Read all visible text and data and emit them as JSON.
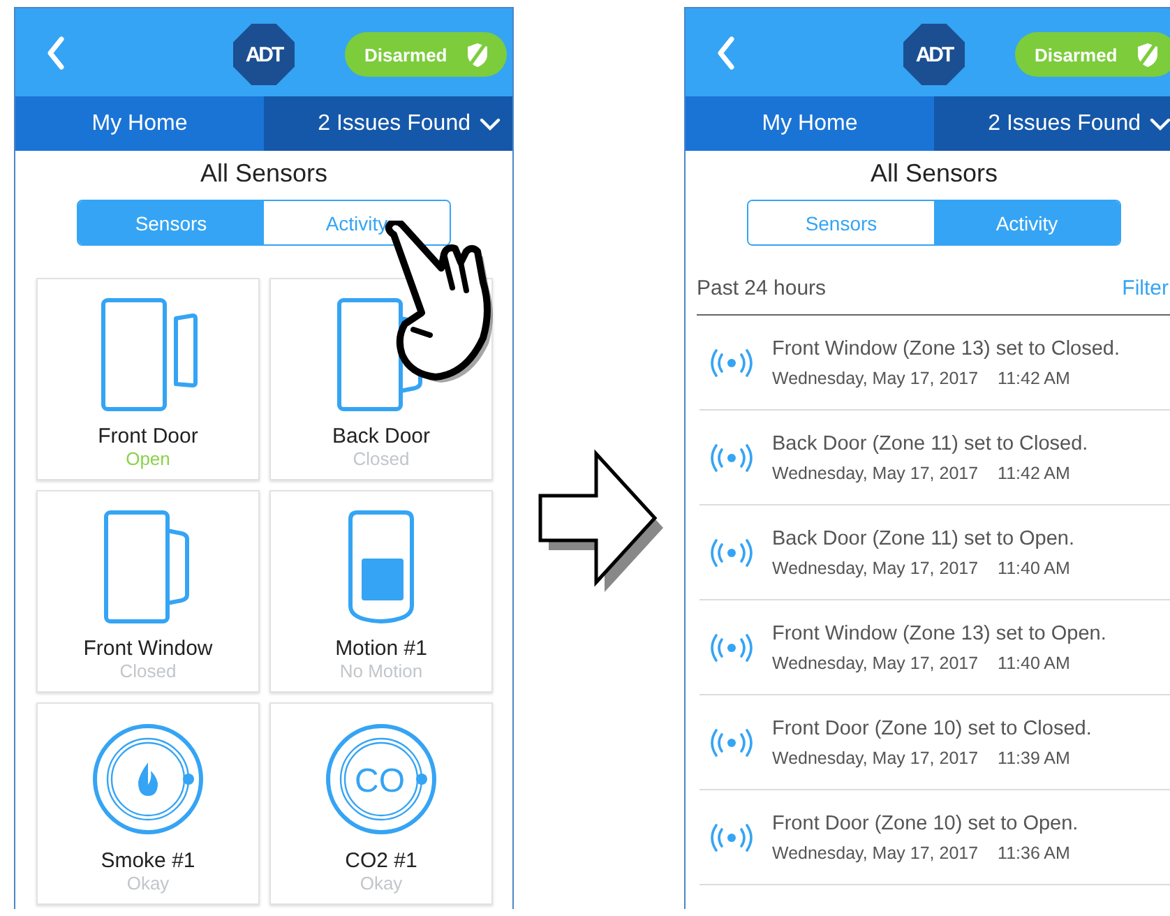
{
  "screens": [
    {
      "header": {
        "logo": "ADT",
        "status": "Disarmed"
      },
      "nav": {
        "home": "My Home",
        "issues": "2 Issues Found"
      },
      "title": "All Sensors",
      "segments": [
        {
          "label": "Sensors",
          "selected": true
        },
        {
          "label": "Activity",
          "selected": false
        }
      ],
      "view": {
        "kind": "grid",
        "sensors": [
          {
            "name": "Front Door",
            "status": "Open",
            "alert": true,
            "kind": "split"
          },
          {
            "name": "Front Window",
            "status": "Closed",
            "alert": false,
            "kind": "joined"
          },
          {
            "name": "Smoke #1",
            "status": "Okay",
            "alert": false,
            "kind": "smoke"
          },
          {
            "name": "Back Door",
            "status": "Closed",
            "alert": false,
            "kind": "joined"
          },
          {
            "name": "Motion #1",
            "status": "No Motion",
            "alert": false,
            "kind": "motion"
          },
          {
            "name": "CO2 #1",
            "status": "Okay",
            "alert": false,
            "kind": "co",
            "icon_text": "CO"
          }
        ]
      }
    },
    {
      "header": {
        "logo": "ADT",
        "status": "Disarmed"
      },
      "nav": {
        "home": "My Home",
        "issues": "2 Issues Found"
      },
      "title": "All Sensors",
      "segments": [
        {
          "label": "Sensors",
          "selected": false
        },
        {
          "label": "Activity",
          "selected": true
        }
      ],
      "view": {
        "kind": "activity",
        "range": "Past 24 hours",
        "filter": "Filter",
        "events": [
          {
            "text": "Front Window (Zone 13) set to Closed.",
            "date": "Wednesday, May 17, 2017",
            "time": "11:42 AM"
          },
          {
            "text": "Back Door (Zone 11) set to Closed.",
            "date": "Wednesday, May 17, 2017",
            "time": "11:42 AM"
          },
          {
            "text": "Back Door (Zone 11) set to Open.",
            "date": "Wednesday, May 17, 2017",
            "time": "11:40 AM"
          },
          {
            "text": "Front Window (Zone 13) set to Open.",
            "date": "Wednesday, May 17, 2017",
            "time": "11:40 AM"
          },
          {
            "text": "Front Door (Zone 10) set to Closed.",
            "date": "Wednesday, May 17, 2017",
            "time": "11:39 AM"
          },
          {
            "text": "Front Door (Zone 10) set to Open.",
            "date": "Wednesday, May 17, 2017",
            "time": "11:36 AM"
          }
        ]
      }
    }
  ]
}
